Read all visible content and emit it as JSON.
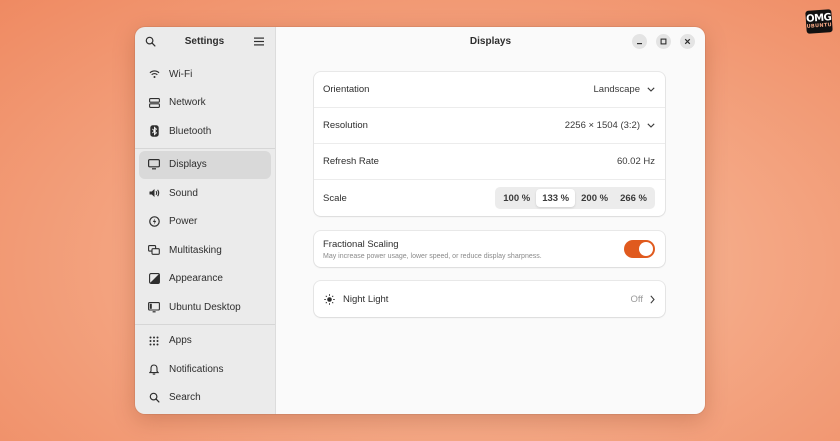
{
  "brand": {
    "line1": "OMG",
    "line2": "UBUNTU"
  },
  "sidebar": {
    "title": "Settings",
    "items": [
      {
        "icon": "wifi-icon",
        "label": "Wi-Fi"
      },
      {
        "icon": "network-icon",
        "label": "Network"
      },
      {
        "icon": "bluetooth-icon",
        "label": "Bluetooth"
      },
      {
        "icon": "display-icon",
        "label": "Displays",
        "active": true
      },
      {
        "icon": "sound-icon",
        "label": "Sound"
      },
      {
        "icon": "power-icon",
        "label": "Power"
      },
      {
        "icon": "multitasking-icon",
        "label": "Multitasking"
      },
      {
        "icon": "appearance-icon",
        "label": "Appearance"
      },
      {
        "icon": "ubuntu-desktop-icon",
        "label": "Ubuntu Desktop"
      },
      {
        "icon": "apps-icon",
        "label": "Apps"
      },
      {
        "icon": "notifications-icon",
        "label": "Notifications"
      },
      {
        "icon": "search-icon",
        "label": "Search"
      }
    ]
  },
  "main": {
    "title": "Displays",
    "display": {
      "orientation": {
        "label": "Orientation",
        "value": "Landscape"
      },
      "resolution": {
        "label": "Resolution",
        "value": "2256 × 1504 (3:2)"
      },
      "refresh": {
        "label": "Refresh Rate",
        "value": "60.02 Hz"
      },
      "scale": {
        "label": "Scale",
        "options": [
          "100 %",
          "133 %",
          "200 %",
          "266 %"
        ],
        "selected": "133 %"
      }
    },
    "fractional": {
      "title": "Fractional Scaling",
      "subtitle": "May increase power usage, lower speed, or reduce display sharpness.",
      "enabled": true
    },
    "night_light": {
      "label": "Night Light",
      "value": "Off"
    }
  },
  "colors": {
    "accent": "#e05a1e",
    "sidebar_bg": "#ebebeb",
    "content_bg": "#fafafa"
  }
}
